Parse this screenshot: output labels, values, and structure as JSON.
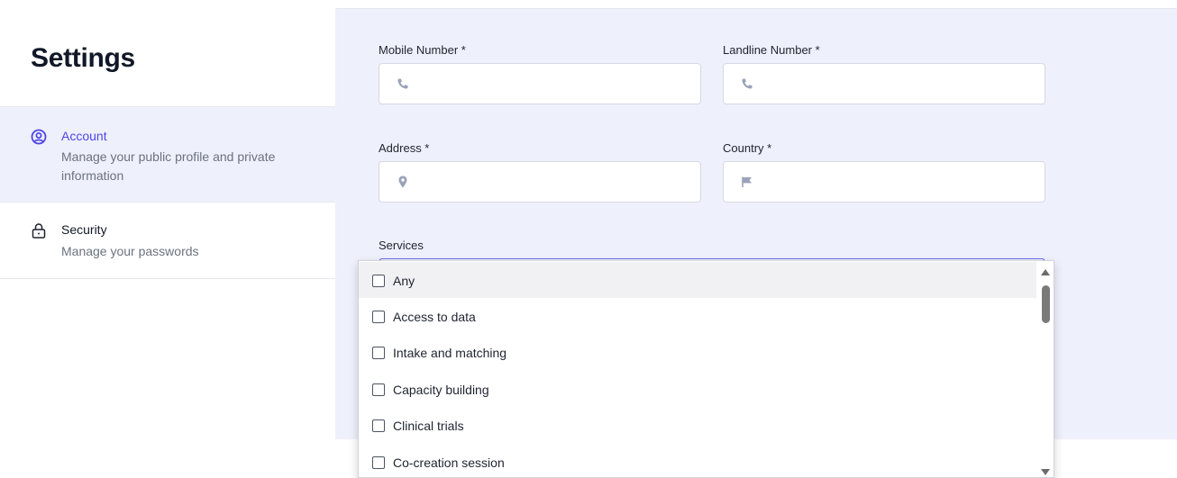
{
  "sidebar": {
    "title": "Settings",
    "items": [
      {
        "label": "Account",
        "description": "Manage your public profile and private information",
        "icon": "user-circle-icon",
        "active": true
      },
      {
        "label": "Security",
        "description": "Manage your passwords",
        "icon": "lock-icon",
        "active": false
      }
    ]
  },
  "form": {
    "mobile": {
      "label": "Mobile Number *",
      "value": "",
      "icon": "phone-icon"
    },
    "landline": {
      "label": "Landline Number *",
      "value": "",
      "icon": "phone-icon"
    },
    "address": {
      "label": "Address *",
      "value": "",
      "icon": "map-pin-icon"
    },
    "country": {
      "label": "Country *",
      "value": "",
      "icon": "flag-icon"
    },
    "services": {
      "label": "Services",
      "options": [
        "Any",
        "Access to data",
        "Intake and matching",
        "Capacity building",
        "Clinical trials",
        "Co-creation session"
      ],
      "highlighted_option": "Any"
    }
  },
  "colors": {
    "accent": "#4f46e5",
    "panel_bg": "#eef0fb",
    "icon_gray": "#9aa3b8"
  }
}
